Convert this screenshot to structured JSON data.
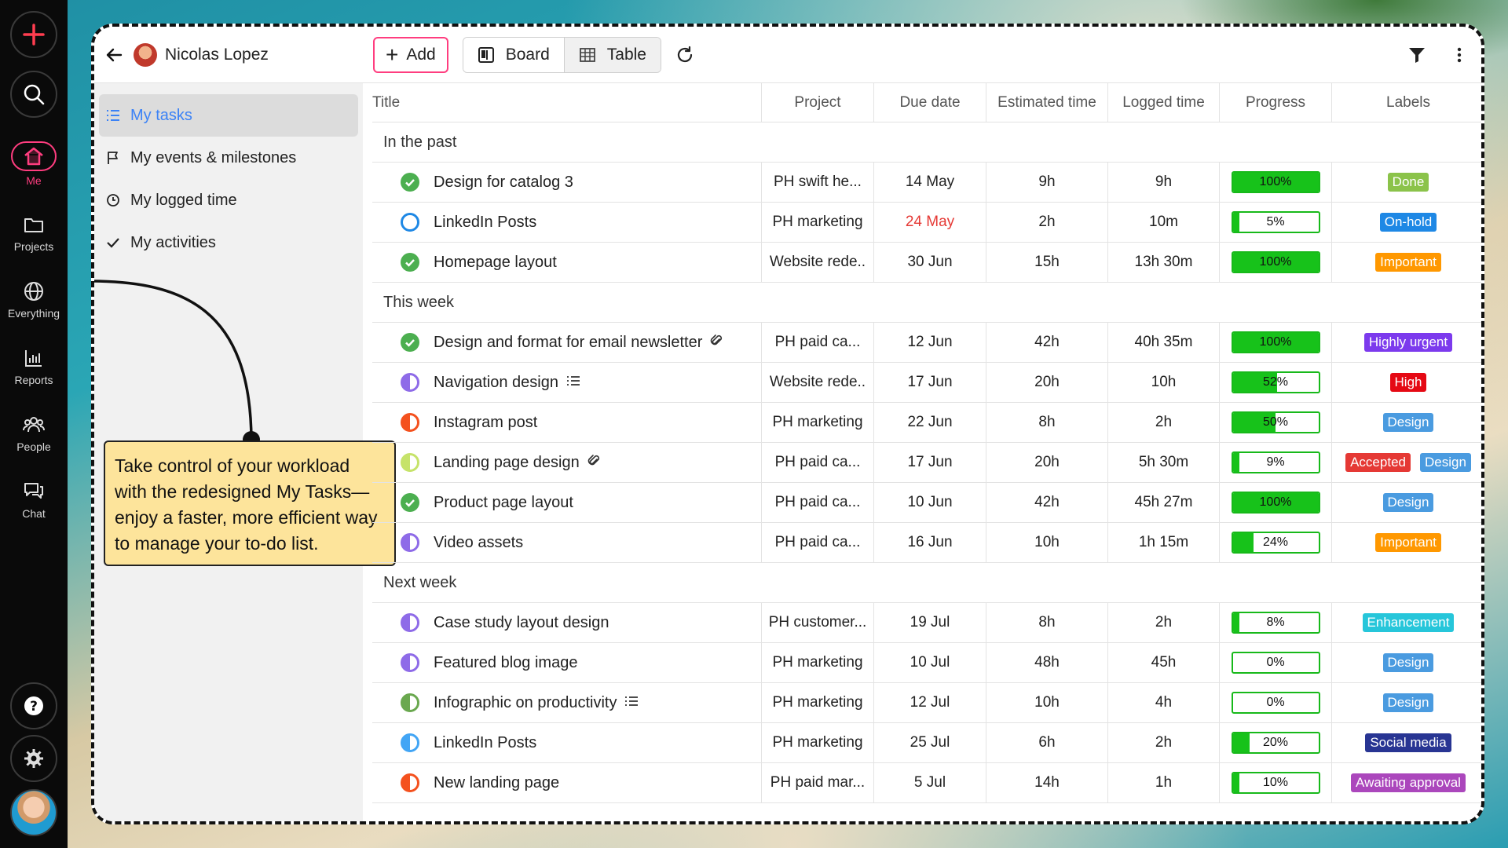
{
  "rail": {
    "items": [
      {
        "label": "Me",
        "icon": "home-icon"
      },
      {
        "label": "Projects",
        "icon": "folder-icon"
      },
      {
        "label": "Everything",
        "icon": "globe-icon"
      },
      {
        "label": "Reports",
        "icon": "bar-chart-icon"
      },
      {
        "label": "People",
        "icon": "people-icon"
      },
      {
        "label": "Chat",
        "icon": "chat-icon"
      }
    ]
  },
  "sidebar": {
    "user_name": "Nicolas Lopez",
    "nav": [
      {
        "label": "My tasks",
        "active": true
      },
      {
        "label": "My events & milestones"
      },
      {
        "label": "My logged time"
      },
      {
        "label": "My activities"
      }
    ]
  },
  "callout": {
    "text": "Take control of your workload with the redesigned My Tasks—enjoy a faster, more efficient way to manage your to-do list."
  },
  "toolbar": {
    "add_label": "Add",
    "board_label": "Board",
    "table_label": "Table"
  },
  "table": {
    "headers": {
      "title": "Title",
      "project": "Project",
      "due": "Due date",
      "estimated": "Estimated time",
      "logged": "Logged time",
      "progress": "Progress",
      "labels": "Labels"
    },
    "groups": [
      {
        "name": "In the past",
        "rows": [
          {
            "title": "Design for catalog 3",
            "status": "done",
            "project": "PH swift he...",
            "due": "14 May",
            "due_overdue": false,
            "est": "9h",
            "logged": "9h",
            "bold": false,
            "progress": 100,
            "progress_text": "100%",
            "labels": [
              {
                "text": "Done",
                "color": "#8bc34a"
              }
            ]
          },
          {
            "title": "LinkedIn Posts",
            "status": "open-blue",
            "project": "PH marketing",
            "due": "24 May",
            "due_overdue": true,
            "est": "2h",
            "logged": "10m",
            "bold": true,
            "progress": 5,
            "progress_text": "5%",
            "labels": [
              {
                "text": "On-hold",
                "color": "#1e88e5"
              }
            ]
          },
          {
            "title": "Homepage layout",
            "status": "done",
            "project": "Website rede..",
            "due": "30 Jun",
            "due_overdue": false,
            "est": "15h",
            "logged": "13h 30m",
            "bold": true,
            "progress": 100,
            "progress_text": "100%",
            "labels": [
              {
                "text": "Important",
                "color": "#ff9800"
              }
            ]
          }
        ]
      },
      {
        "name": "This week",
        "rows": [
          {
            "title": "Design and format for email newsletter",
            "extra": "attachment",
            "status": "done",
            "project": "PH paid ca...",
            "due": "12 Jun",
            "due_overdue": false,
            "est": "42h",
            "logged": "40h 35m",
            "bold": false,
            "progress": 100,
            "progress_text": "100%",
            "labels": [
              {
                "text": "Highly urgent",
                "color": "#7c3aed"
              }
            ]
          },
          {
            "title": "Navigation design",
            "extra": "list",
            "status": "half-purple",
            "project": "Website rede..",
            "due": "17 Jun",
            "due_overdue": false,
            "est": "20h",
            "logged": "10h",
            "bold": false,
            "progress": 52,
            "progress_text": "52%",
            "labels": [
              {
                "text": "High",
                "color": "#e50914"
              }
            ]
          },
          {
            "title": "Instagram post",
            "status": "half-orange",
            "project": "PH marketing",
            "due": "22 Jun",
            "due_overdue": false,
            "est": "8h",
            "logged": "2h",
            "bold": false,
            "progress": 50,
            "progress_text": "50%",
            "labels": [
              {
                "text": "Design",
                "color": "#4a9be0"
              }
            ]
          },
          {
            "title": "Landing page design",
            "extra": "attachment",
            "status": "half-lime",
            "project": "PH paid ca...",
            "due": "17 Jun",
            "due_overdue": false,
            "est": "20h",
            "logged": "5h 30m",
            "bold": false,
            "progress": 9,
            "progress_text": "9%",
            "labels": [
              {
                "text": "Accepted",
                "color": "#e53935"
              },
              {
                "text": "Design",
                "color": "#4a9be0"
              }
            ]
          },
          {
            "title": "Product page layout",
            "status": "done",
            "project": "PH paid ca...",
            "due": "10 Jun",
            "due_overdue": false,
            "est": "42h",
            "logged": "45h 27m",
            "bold": false,
            "progress": 100,
            "progress_text": "100%",
            "labels": [
              {
                "text": "Design",
                "color": "#4a9be0"
              }
            ]
          },
          {
            "title": "Video assets",
            "status": "half-purple",
            "project": "PH paid ca...",
            "due": "16 Jun",
            "due_overdue": false,
            "est": "10h",
            "logged": "1h 15m",
            "bold": false,
            "progress": 24,
            "progress_text": "24%",
            "labels": [
              {
                "text": "Important",
                "color": "#ff9800"
              }
            ]
          }
        ]
      },
      {
        "name": "Next week",
        "rows": [
          {
            "title": "Case study layout design",
            "status": "half-purple",
            "project": "PH customer...",
            "due": "19 Jul",
            "due_overdue": false,
            "est": "8h",
            "logged": "2h",
            "bold": false,
            "progress": 8,
            "progress_text": "8%",
            "labels": [
              {
                "text": "Enhancement",
                "color": "#26c6da"
              }
            ]
          },
          {
            "title": "Featured blog image",
            "status": "half-purple",
            "project": "PH marketing",
            "due": "10 Jul",
            "due_overdue": false,
            "est": "48h",
            "logged": "45h",
            "bold": false,
            "progress": 0,
            "progress_text": "0%",
            "labels": [
              {
                "text": "Design",
                "color": "#4a9be0"
              }
            ]
          },
          {
            "title": "Infographic on productivity",
            "extra": "list",
            "status": "half-green",
            "project": "PH marketing",
            "due": "12 Jul",
            "due_overdue": false,
            "est": "10h",
            "logged": "4h",
            "bold": false,
            "progress": 0,
            "progress_text": "0%",
            "labels": [
              {
                "text": "Design",
                "color": "#4a9be0"
              }
            ]
          },
          {
            "title": "LinkedIn Posts",
            "status": "half-blue",
            "project": "PH marketing",
            "due": "25 Jul",
            "due_overdue": false,
            "est": "6h",
            "logged": "2h",
            "bold": false,
            "progress": 20,
            "progress_text": "20%",
            "labels": [
              {
                "text": "Social media",
                "color": "#283593"
              }
            ]
          },
          {
            "title": "New landing page",
            "status": "half-orange",
            "project": "PH  paid mar...",
            "due": "5 Jul",
            "due_overdue": false,
            "est": "14h",
            "logged": "1h",
            "bold": false,
            "progress": 10,
            "progress_text": "10%",
            "labels": [
              {
                "text": "Awaiting approval",
                "color": "#ab47bc"
              }
            ]
          }
        ]
      }
    ]
  },
  "colors": {
    "accent": "#ff3d7f",
    "progress_green": "#17c21a",
    "active_nav_text": "#3b82f6"
  }
}
